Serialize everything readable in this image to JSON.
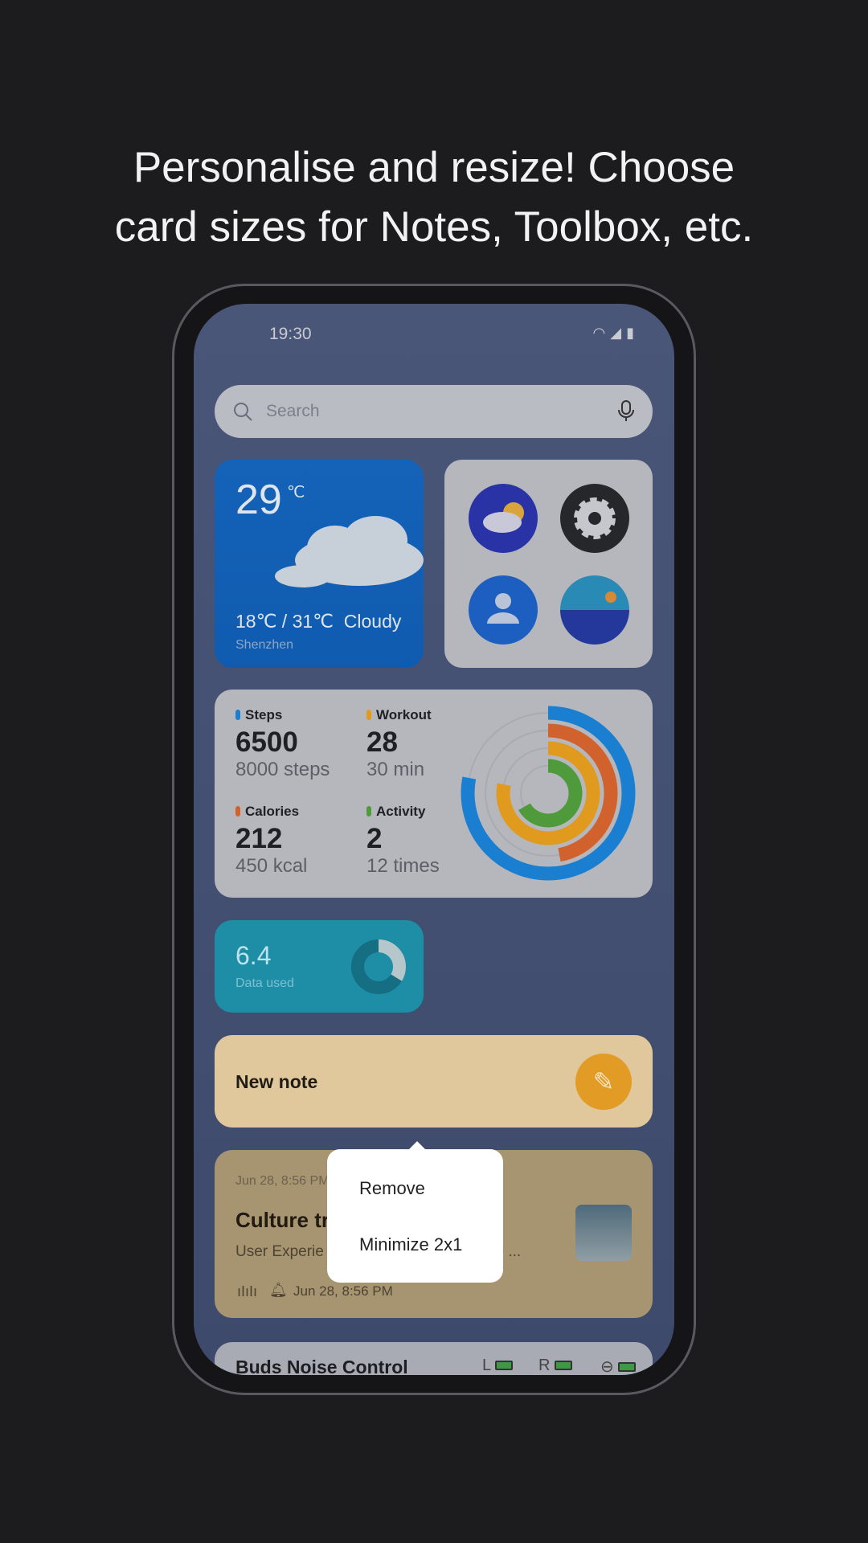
{
  "headline": {
    "line1": "Personalise and resize! Choose",
    "line2": "card sizes for Notes, Toolbox, etc."
  },
  "status": {
    "time": "19:30",
    "icons": [
      "wifi-icon",
      "signal-icon",
      "battery-icon"
    ]
  },
  "search": {
    "placeholder": "Search"
  },
  "weather": {
    "temp": "29",
    "unit": "℃",
    "range": "18℃ / 31℃",
    "condition": "Cloudy",
    "city": "Shenzhen"
  },
  "apps": [
    {
      "name": "weather-app"
    },
    {
      "name": "settings-app"
    },
    {
      "name": "contacts-app"
    },
    {
      "name": "gallery-app"
    }
  ],
  "fitness": {
    "steps": {
      "label": "Steps",
      "value": "6500",
      "goal": "8000 steps",
      "color": "#1a7fd0"
    },
    "workout": {
      "label": "Workout",
      "value": "28",
      "goal": "30 min",
      "color": "#e09a1e"
    },
    "calories": {
      "label": "Calories",
      "value": "212",
      "goal": "450 kcal",
      "color": "#d2622d"
    },
    "activity": {
      "label": "Activity",
      "value": "2",
      "goal": "12 times",
      "color": "#4f9a3a"
    }
  },
  "data_usage": {
    "value": "6.4",
    "label": "Data used"
  },
  "new_note": {
    "label": "New note"
  },
  "note": {
    "date": "Jun 28, 8:56 PM",
    "title": "Culture tr",
    "preview_start": "User Experie",
    "preview_end": "ve ...",
    "reminder": "Jun 28, 8:56 PM"
  },
  "menu": {
    "remove": "Remove",
    "minimize": "Minimize 2x1"
  },
  "buds": {
    "title": "Buds Noise Control",
    "left": "L",
    "right": "R"
  }
}
